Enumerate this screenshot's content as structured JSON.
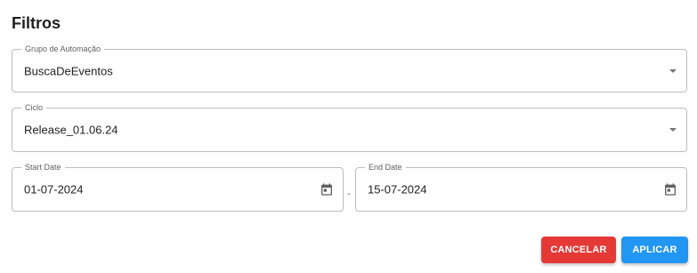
{
  "dialog": {
    "title": "Filtros"
  },
  "filters": {
    "grupo": {
      "label": "Grupo de Automação",
      "value": "BuscaDeEventos"
    },
    "ciclo": {
      "label": "Ciclo",
      "value": "Release_01.06.24"
    },
    "start_date": {
      "label": "Start Date",
      "value": "01-07-2024"
    },
    "separator": "-",
    "end_date": {
      "label": "End Date",
      "value": "15-07-2024"
    }
  },
  "actions": {
    "cancel_label": "CANCELAR",
    "apply_label": "APLICAR"
  },
  "icons": {
    "select_caret": "caret-down-icon",
    "date_picker": "calendar-icon"
  },
  "colors": {
    "cancel": "#e53935",
    "apply": "#2196f3"
  }
}
